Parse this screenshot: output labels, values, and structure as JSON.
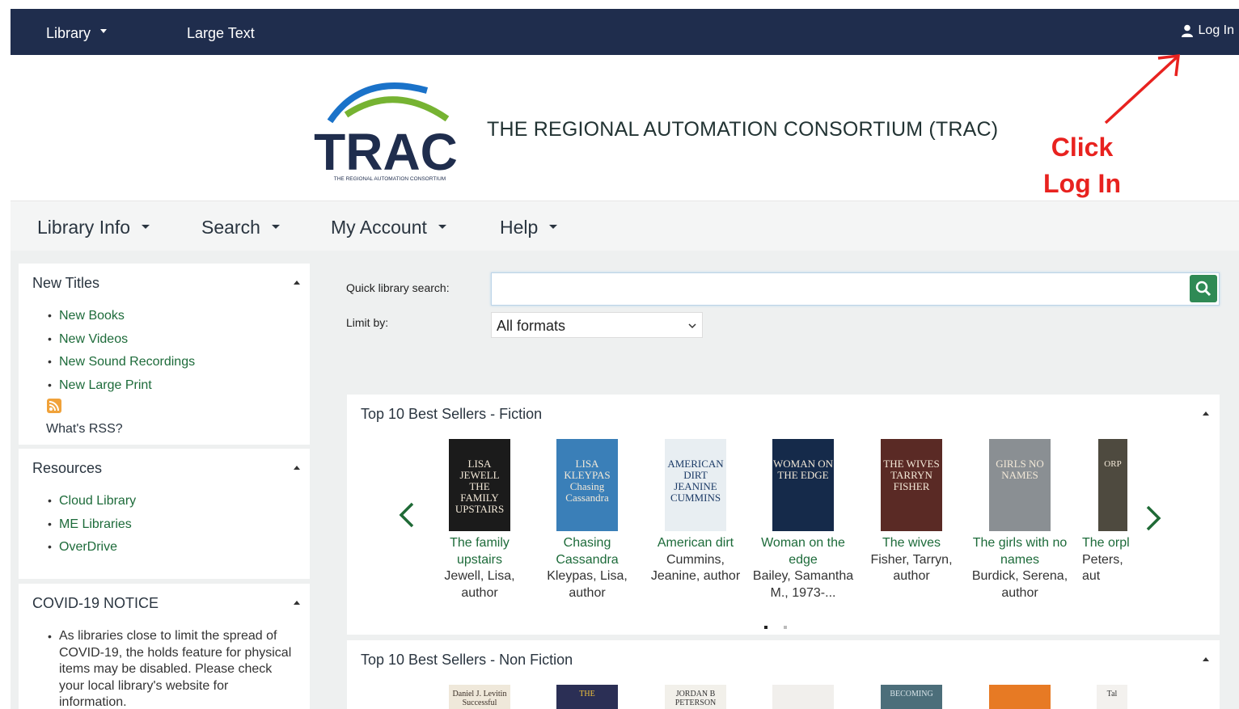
{
  "topbar": {
    "library": "Library",
    "large_text": "Large Text",
    "login": "Log In"
  },
  "header": {
    "title": "THE REGIONAL AUTOMATION CONSORTIUM (TRAC)",
    "logo_text": "TRAC",
    "logo_sub": "THE REGIONAL AUTOMATION CONSORTIUM"
  },
  "annotation": {
    "line1": "Click",
    "line2": "Log In"
  },
  "mainnav": [
    "Library Info",
    "Search",
    "My Account",
    "Help"
  ],
  "panels": {
    "new_titles": {
      "title": "New Titles",
      "items": [
        "New Books",
        "New Videos",
        "New Sound Recordings",
        "New Large Print"
      ],
      "rss": "What's RSS?"
    },
    "resources": {
      "title": "Resources",
      "items": [
        "Cloud Library",
        "ME Libraries",
        "OverDrive"
      ]
    },
    "covid": {
      "title": "COVID-19 NOTICE",
      "text": "As libraries close to limit the spread of COVID-19, the holds feature for physical items may be disabled. Please check your local library's website for information."
    }
  },
  "search": {
    "label": "Quick library search:",
    "value": "",
    "limit_label": "Limit by:",
    "limit_value": "All formats"
  },
  "fiction": {
    "title": "Top 10 Best Sellers - Fiction",
    "books": [
      {
        "title": "The family upstairs",
        "author": "Jewell, Lisa, author",
        "cover": "LISA JEWELL THE FAMILY UPSTAIRS",
        "color": "#1b1b1b"
      },
      {
        "title": "Chasing Cassandra",
        "author": "Kleypas, Lisa, author",
        "cover": "LISA KLEYPAS Chasing Cassandra",
        "color": "#3a7fb8"
      },
      {
        "title": "American dirt",
        "author": "Cummins, Jeanine, author",
        "cover": "AMERICAN DIRT JEANINE CUMMINS",
        "color": "#e8eef2"
      },
      {
        "title": "Woman on the edge",
        "author": "Bailey, Samantha M., 1973-...",
        "cover": "WOMAN ON THE EDGE",
        "color": "#152a4a"
      },
      {
        "title": "The wives",
        "author": "Fisher, Tarryn, author",
        "cover": "THE WIVES TARRYN FISHER",
        "color": "#5a2a25"
      },
      {
        "title": "The girls with no names",
        "author": "Burdick, Serena, author",
        "cover": "GIRLS NO NAMES",
        "color": "#8a8f93"
      },
      {
        "title": "The orpl",
        "author": "Peters, aut",
        "cover": "ORP",
        "color": "#4e4a3f"
      }
    ]
  },
  "nonfiction": {
    "title": "Top 10 Best Sellers - Non Fiction",
    "covers": [
      "Daniel J. Levitin Successful",
      "THE",
      "JORDAN B PETERSON",
      "",
      "BECOMING",
      "",
      "Tal"
    ]
  },
  "colors": {
    "topbar": "#1f2d4d",
    "link": "#1d6b3a",
    "accent": "#2f8a55",
    "annotation": "#e8221f"
  }
}
